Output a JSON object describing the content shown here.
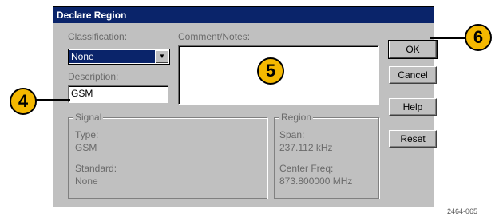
{
  "dialog": {
    "title": "Declare Region",
    "classification_label": "Classification:",
    "classification_value": "None",
    "comment_label": "Comment/Notes:",
    "comment_value": "",
    "description_label": "Description:",
    "description_value": "GSM"
  },
  "signal": {
    "legend": "Signal",
    "type_label": "Type:",
    "type_value": "GSM",
    "standard_label": "Standard:",
    "standard_value": "None"
  },
  "region": {
    "legend": "Region",
    "span_label": "Span:",
    "span_value": "237.112 kHz",
    "center_label": "Center Freq:",
    "center_value": "873.800000 MHz"
  },
  "buttons": {
    "ok": "OK",
    "cancel": "Cancel",
    "help": "Help",
    "reset": "Reset"
  },
  "callouts": {
    "c4": "4",
    "c5": "5",
    "c6": "6"
  },
  "figure_id": "2464-065",
  "colors": {
    "titlebar": "#0a246a",
    "dialog_bg": "#c0c0c0",
    "callout": "#f5b800"
  }
}
